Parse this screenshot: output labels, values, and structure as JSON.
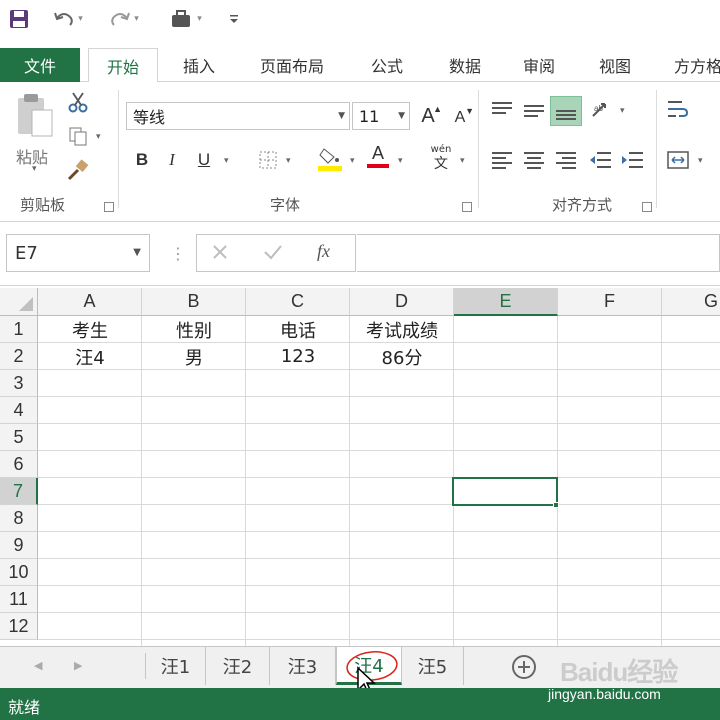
{
  "quick_access": {
    "icons": [
      "save-icon",
      "undo-icon",
      "redo-icon",
      "touch-mode-icon",
      "customize-qat-icon"
    ]
  },
  "ribbon_tabs": {
    "file": "文件",
    "home": "开始",
    "insert": "插入",
    "page_layout": "页面布局",
    "formulas": "公式",
    "data": "数据",
    "review": "审阅",
    "view": "视图",
    "addin": "方方格"
  },
  "clipboard": {
    "paste_label": "粘贴",
    "group_label": "剪贴板"
  },
  "font_group": {
    "font_name": "等线",
    "font_size": "11",
    "group_label": "字体",
    "bold": "B",
    "italic": "I",
    "underline": "U",
    "grow": "A",
    "shrink": "A",
    "color_a": "A",
    "phonetic_top": "wén",
    "phonetic_bottom": "文"
  },
  "align_group": {
    "group_label": "对齐方式"
  },
  "formula_bar": {
    "name_box": "E7",
    "fx": "fx",
    "formula": ""
  },
  "accent_color": "#217346",
  "columns": [
    "A",
    "B",
    "C",
    "D",
    "E",
    "F",
    "G"
  ],
  "selected_column": "E",
  "rows": [
    "1",
    "2",
    "3",
    "4",
    "5",
    "6",
    "7",
    "8",
    "9",
    "10",
    "11",
    "12"
  ],
  "selected_row": "7",
  "cells": {
    "A1": "考生",
    "B1": "性别",
    "C1": "电话",
    "D1": "考试成绩",
    "A2": "汪4",
    "B2": "男",
    "C2": "123",
    "D2": "86分"
  },
  "sheet_tabs": [
    "汪1",
    "汪2",
    "汪3",
    "汪4",
    "汪5"
  ],
  "active_sheet": "汪4",
  "status": {
    "text": "就绪"
  },
  "watermark": {
    "brand": "Baidu经验",
    "site": "jingyan.baidu.com"
  }
}
